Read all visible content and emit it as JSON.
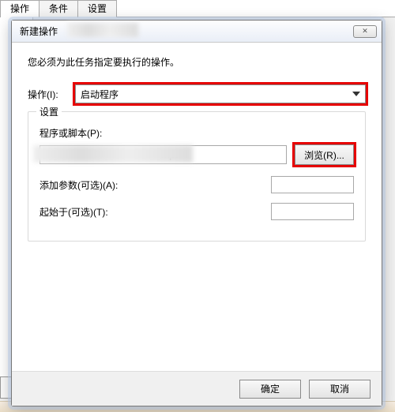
{
  "back_tabs": {
    "t0": "操作",
    "t1": "条件",
    "t2": "设置"
  },
  "dialog": {
    "title": "新建操作",
    "close_glyph": "✕",
    "instruction": "您必须为此任务指定要执行的操作。",
    "action_label": "操作(I):",
    "action_value": "启动程序",
    "group_legend": "设置",
    "script_label": "程序或脚本(P):",
    "script_value": ".mp3\"",
    "browse_label": "浏览(R)...",
    "args_label": "添加参数(可选)(A):",
    "args_value": "",
    "startin_label": "起始于(可选)(T):",
    "startin_value": "",
    "ok_label": "确定",
    "cancel_label": "取消"
  }
}
